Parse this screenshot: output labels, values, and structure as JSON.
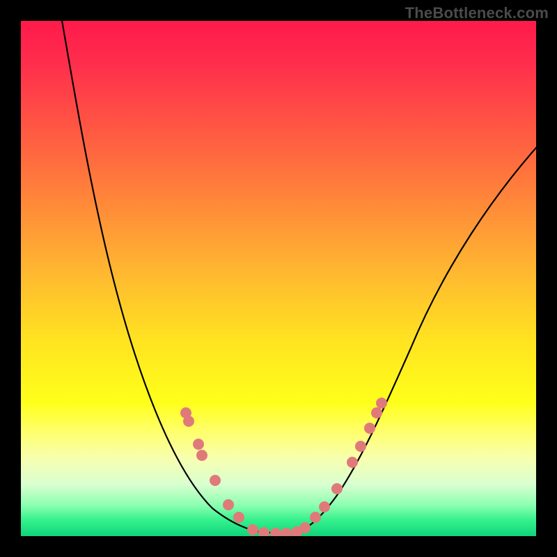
{
  "attribution": "TheBottleneck.com",
  "colors": {
    "gradient_top": "#ff1a4b",
    "gradient_mid": "#ffe321",
    "gradient_bottom": "#10d47a",
    "curve": "#000000",
    "dots": "#e07a7a",
    "frame": "#000000"
  },
  "chart_data": {
    "type": "line",
    "title": "",
    "xlabel": "",
    "ylabel": "",
    "xlim": [
      0,
      100
    ],
    "ylim": [
      0,
      100
    ],
    "description": "Asymmetric V-shaped bottleneck curve on a red-to-green vertical gradient. Left arm starts near top-left corner and descends steeply; flat minimum near x≈45-53 at y≈0; right arm rises more gently toward upper-right, ending around y≈75 at x=100. Salmon-colored dots lie on the curve only in the lower ~30% of the y-range.",
    "series": [
      {
        "name": "curve",
        "x": [
          7,
          12,
          18,
          24,
          30,
          35,
          40,
          44,
          48,
          50,
          53,
          56,
          60,
          65,
          70,
          76,
          84,
          92,
          100
        ],
        "y": [
          105,
          88,
          68,
          50,
          34,
          22,
          12,
          5,
          1,
          0,
          0,
          1,
          5,
          12,
          22,
          34,
          50,
          64,
          76
        ]
      },
      {
        "name": "dots_on_curve",
        "x": [
          32,
          33,
          35,
          36,
          38,
          40,
          43,
          45,
          47,
          50,
          52,
          54,
          55,
          57,
          59,
          61,
          64,
          66,
          68,
          69,
          70
        ],
        "y": [
          24,
          22,
          18,
          16,
          11,
          6,
          3,
          1,
          0.5,
          0,
          0,
          0.5,
          1,
          3,
          6,
          9,
          14,
          17,
          21,
          24,
          26
        ]
      }
    ]
  }
}
